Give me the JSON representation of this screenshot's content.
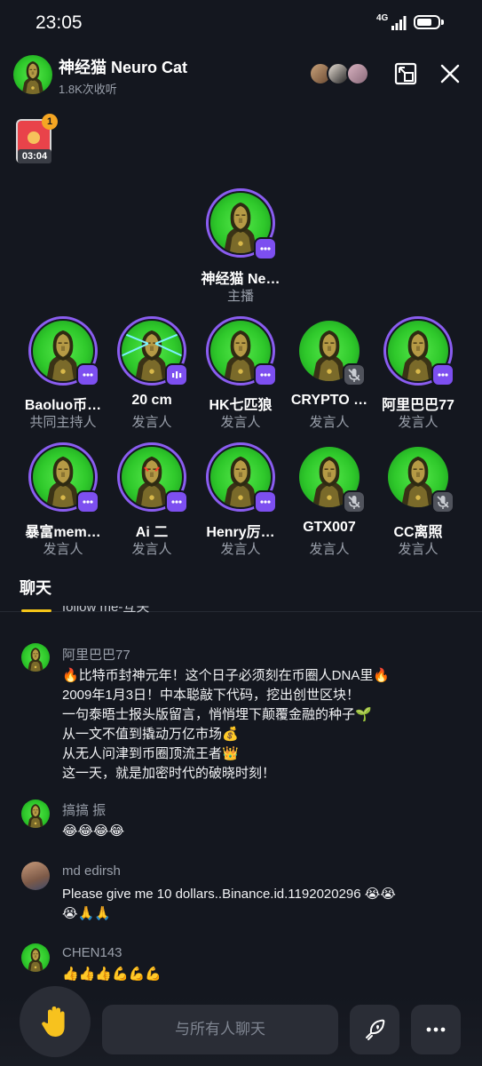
{
  "status_bar": {
    "time": "23:05",
    "network": "4G"
  },
  "header": {
    "title": "神经猫 Neuro Cat",
    "listeners": "1.8K次收听"
  },
  "red_packet": {
    "count": "1",
    "timer": "03:04"
  },
  "host": {
    "name": "神经猫 Ne…",
    "role": "主播"
  },
  "speakers_row1": [
    {
      "name": "Baoluo币…",
      "role": "共同主持人"
    },
    {
      "name": "20 cm",
      "role": "发言人"
    },
    {
      "name": "HK七匹狼",
      "role": "发言人"
    },
    {
      "name": "CRYPTO …",
      "role": "发言人"
    },
    {
      "name": "阿里巴巴77",
      "role": "发言人"
    }
  ],
  "speakers_row2": [
    {
      "name": "暴富mem…",
      "role": "发言人"
    },
    {
      "name": "Ai 二",
      "role": "发言人"
    },
    {
      "name": "Henry厉…",
      "role": "发言人"
    },
    {
      "name": "GTX007",
      "role": "发言人"
    },
    {
      "name": "CC离照",
      "role": "发言人"
    }
  ],
  "chat": {
    "tab_label": "聊天",
    "cut_text": "follow me-互关",
    "messages": [
      {
        "user": "阿里巴巴77",
        "text": "🔥比特币封神元年！这个日子必须刻在币圈人DNA里🔥\n2009年1月3日！中本聪敲下代码，挖出创世区块！\n一句泰晤士报头版留言，悄悄埋下颠覆金融的种子🌱\n从一文不值到撬动万亿市场💰\n从无人问津到币圈顶流王者👑\n这一天，就是加密时代的破晓时刻！"
      },
      {
        "user": "搞搞  振",
        "text": "😂😂😂😂"
      },
      {
        "user": "md  edirsh",
        "text": "Please give me 10 dollars..Binance.id.1192020296 😭😭\n😭🙏🙏"
      },
      {
        "user": "CHEN143",
        "text": "👍👍👍💪💪💪"
      }
    ]
  },
  "bottom_bar": {
    "input_placeholder": "与所有人聊天"
  },
  "colors": {
    "background": "#14171f",
    "accent_purple": "#7d4ff0",
    "tab_underline": "#f5c518"
  }
}
